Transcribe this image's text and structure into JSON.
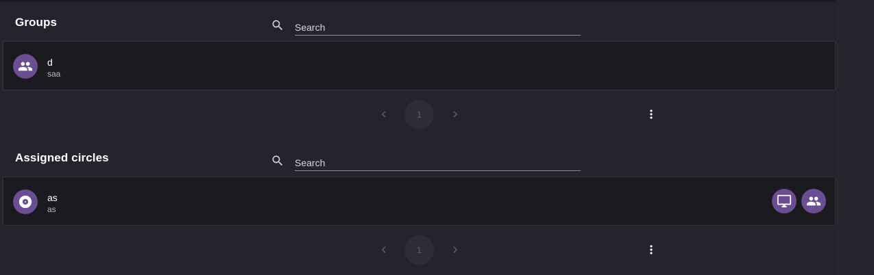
{
  "groups": {
    "title": "Groups",
    "search": {
      "placeholder": "Search",
      "value": ""
    },
    "items": [
      {
        "name": "d",
        "subtitle": "saa",
        "avatar_icon": "group-icon"
      }
    ],
    "pagination": {
      "current_page": "1"
    }
  },
  "circles": {
    "title": "Assigned circles",
    "search": {
      "placeholder": "Search",
      "value": ""
    },
    "items": [
      {
        "name": "as",
        "subtitle": "as",
        "avatar_icon": "disc-icon",
        "actions": [
          "monitor-icon",
          "group-icon"
        ]
      }
    ],
    "pagination": {
      "current_page": "1"
    }
  },
  "colors": {
    "background": "#25232d",
    "card": "#1b1a1e",
    "accent": "#6a4d93",
    "text": "#ffffff",
    "muted_text": "#b9b7c0"
  }
}
